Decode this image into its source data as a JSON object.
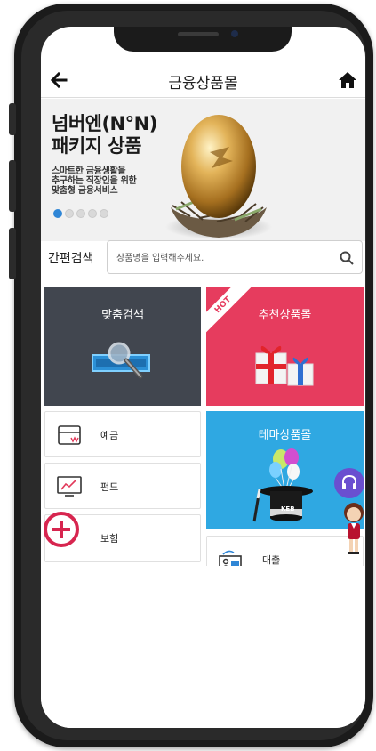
{
  "header": {
    "title": "금융상품몰",
    "back_icon": "arrow-left-icon",
    "home_icon": "home-icon"
  },
  "banner": {
    "title_line1": "넘버엔(N°N)",
    "title_line2": "패키지 상품",
    "desc_line1": "스마트한 금융생활을",
    "desc_line2": "추구하는 직장인을 위한",
    "desc_line3": "맞춤형 금융서비스",
    "dots_total": 5,
    "active_dot": 1,
    "image": "golden-egg-in-nest"
  },
  "search": {
    "label": "간편검색",
    "placeholder": "상품명을 입력해주세요.",
    "value": ""
  },
  "tiles": {
    "custom_search": "맞춤검색",
    "recommend": "추천상품몰",
    "recommend_badge": "HOT",
    "theme": "테마상품몰",
    "theme_hat_text": "KEB"
  },
  "menu": {
    "deposit": "예금",
    "fund": "펀드",
    "insurance": "보험",
    "loan": "대출"
  },
  "colors": {
    "tile_dark": "#41464f",
    "tile_red": "#e63c5e",
    "tile_blue": "#2fa8e2",
    "accent_red": "#d7254f",
    "dot_active": "#2f86d6"
  }
}
